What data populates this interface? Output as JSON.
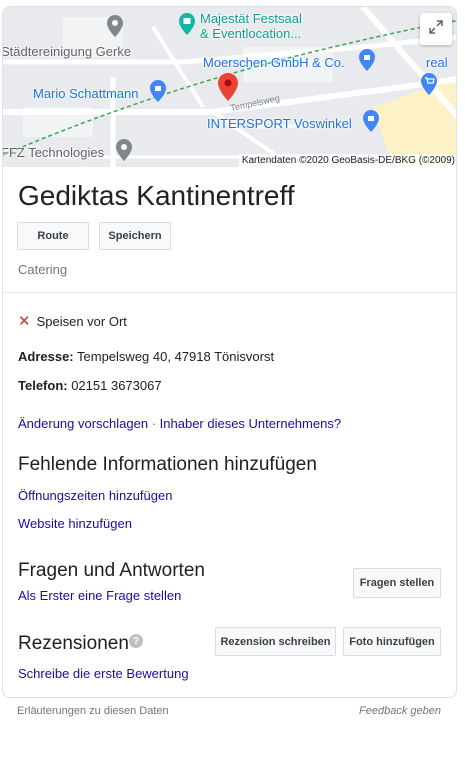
{
  "map": {
    "labels": {
      "festsaal": "Majestät Festsaal",
      "eventlocation": "& Eventlocation...",
      "staedtereinigung": "Städtereinigung Gerke",
      "moerschen": "Moerschen GmbH & Co.",
      "real": "real",
      "schattmann": "Mario Schattmann",
      "intersport": "INTERSPORT Voswinkel",
      "ffz": "FFZ Technologies",
      "street": "Tempelsweg"
    },
    "attribution": "Kartendaten ©2020 GeoBasis-DE/BKG (©2009)",
    "expand_icon": "expand-icon"
  },
  "business": {
    "name": "Gediktas Kantinentreff",
    "route_label": "Route",
    "save_label": "Speichern",
    "category": "Catering",
    "dine_in": "Speisen vor Ort",
    "address_label": "Adresse:",
    "address_value": " Tempelsweg 40, 47918 Tönisvorst",
    "phone_label": "Telefon:",
    "phone_value": " 02151 3673067",
    "suggest_edit": "Änderung vorschlagen",
    "separator": " · ",
    "owner_link": "Inhaber dieses Unternehmens?"
  },
  "missing_info": {
    "title": "Fehlende Informationen hinzufügen",
    "hours_link": "Öffnungszeiten hinzufügen",
    "website_link": "Website hinzufügen"
  },
  "qa": {
    "title": "Fragen und Antworten",
    "first_question_link": "Als Erster eine Frage stellen",
    "ask_button": "Fragen stellen"
  },
  "reviews": {
    "title": "Rezensionen",
    "help_icon": "?",
    "write_review_button": "Rezension schreiben",
    "add_photo_button": "Foto hinzufügen",
    "first_review_link": "Schreibe die erste Bewertung"
  },
  "footer": {
    "explanations": "Erläuterungen zu diesen Daten",
    "feedback": "Feedback geben"
  },
  "colors": {
    "link": "#1a0dab",
    "map_blue": "#1a73e8",
    "pin_red": "#ea4335"
  }
}
